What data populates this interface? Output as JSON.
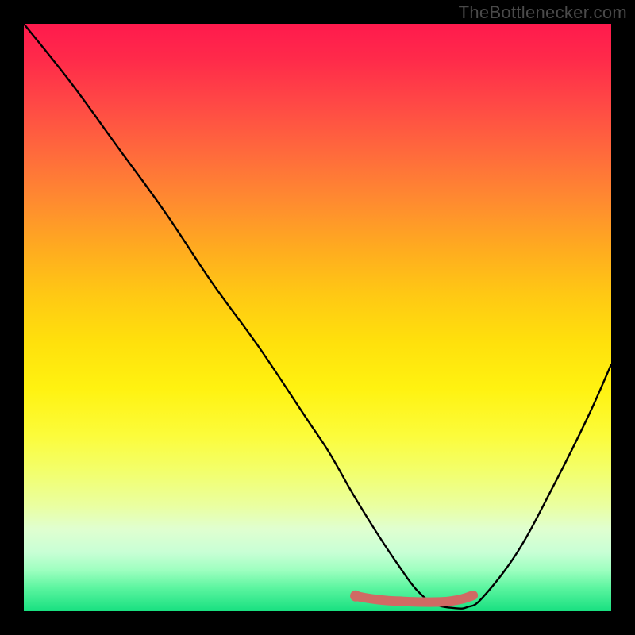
{
  "watermark": "TheBottlenecker.com",
  "chart_data": {
    "type": "line",
    "title": "",
    "xlabel": "",
    "ylabel": "",
    "xlim": [
      0,
      100
    ],
    "ylim": [
      0,
      100
    ],
    "series": [
      {
        "name": "bottleneck-curve",
        "x": [
          0,
          8,
          16,
          24,
          32,
          40,
          48,
          52,
          56,
          60,
          64,
          67,
          70,
          73.5,
          75.5,
          78,
          84,
          90,
          96,
          100
        ],
        "values": [
          100,
          90,
          79,
          68,
          56,
          45,
          33,
          27,
          20,
          13.5,
          7.5,
          3.5,
          1.2,
          0.5,
          0.7,
          2.2,
          10,
          21,
          33,
          42
        ]
      },
      {
        "name": "optimal-zone",
        "x": [
          56.5,
          58,
          60,
          62,
          64,
          66,
          68,
          70,
          71.5,
          72.5,
          73.5,
          74.5,
          75.5,
          76.5
        ],
        "values": [
          2.6,
          2.3,
          2.0,
          1.8,
          1.7,
          1.6,
          1.55,
          1.55,
          1.6,
          1.7,
          1.85,
          2.05,
          2.35,
          2.7
        ]
      }
    ],
    "markers": [
      {
        "name": "start-dot",
        "x": 56.5,
        "y": 2.6
      }
    ],
    "colors": {
      "curve": "#000000",
      "optimal_zone": "#d06a64",
      "marker": "#d06a64"
    },
    "stroke_width": {
      "curve": 2.4,
      "optimal_zone": 12
    }
  }
}
